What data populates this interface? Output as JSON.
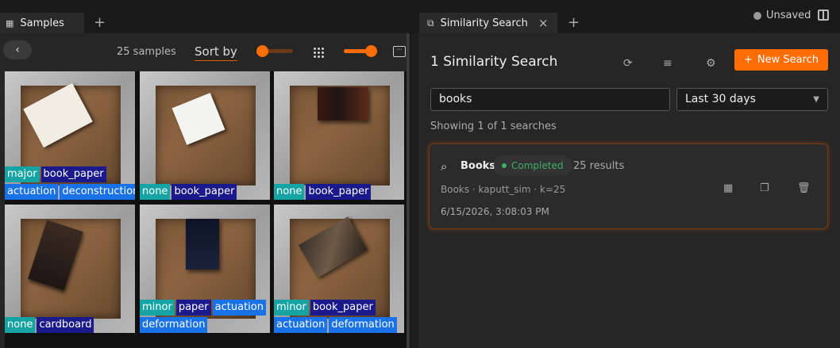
{
  "tabs": {
    "samples": {
      "label": "Samples"
    },
    "similarity": {
      "label": "Similarity Search"
    },
    "add_symbol": "+"
  },
  "status": {
    "unsaved": "Unsaved"
  },
  "samples_panel": {
    "back_symbol": "‹",
    "count": "25 samples",
    "sort_label": "Sort by",
    "accent": "#ff6d04",
    "samples": [
      {
        "rows": [
          [
            "major",
            "book_paper"
          ],
          [
            "actuation",
            "deconstruction"
          ]
        ]
      },
      {
        "rows": [
          [
            "none",
            "book_paper"
          ]
        ]
      },
      {
        "rows": [
          [
            "none",
            "book_paper"
          ]
        ]
      },
      {
        "rows": [
          [
            "none",
            "cardboard"
          ]
        ]
      },
      {
        "rows": [
          [
            "minor",
            "paper",
            "actuation"
          ],
          [
            "deformation"
          ]
        ]
      },
      {
        "rows": [
          [
            "minor",
            "book_paper"
          ],
          [
            "actuation",
            "deformation"
          ]
        ]
      }
    ]
  },
  "similarity_panel": {
    "title": "1 Similarity Search",
    "new_search_label": "New Search",
    "new_search_icon": "+",
    "query_value": "books",
    "range_value": "Last 30 days",
    "showing": "Showing 1 of 1 searches",
    "card": {
      "name": "Books",
      "status": "Completed",
      "results": "25 results",
      "meta": "Books · kaputt_sim · k=25",
      "date": "6/15/2026, 3:08:03 PM"
    }
  },
  "colors": {
    "accent": "#ff6d04",
    "tag_teal": "#16a3a3",
    "tag_navy": "#1a1a8c",
    "tag_blue": "#1a72e8"
  }
}
